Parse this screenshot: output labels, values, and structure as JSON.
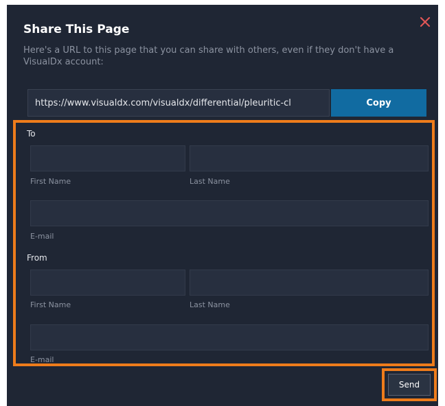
{
  "dialog": {
    "title": "Share This Page",
    "description": "Here's a URL to this page that you can share with others, even if they don't have a VisualDx account:",
    "close_icon": "close-icon",
    "close_color": "#e05656"
  },
  "share_url": {
    "value": "https://www.visualdx.com/visualdx/differential/pleuritic-cl",
    "copy_label": "Copy"
  },
  "to": {
    "heading": "To",
    "first_name_label": "First Name",
    "last_name_label": "Last Name",
    "email_label": "E-mail"
  },
  "from": {
    "heading": "From",
    "first_name_label": "First Name",
    "last_name_label": "Last Name",
    "email_label": "E-mail"
  },
  "send_label": "Send",
  "colors": {
    "dialog_bg": "#1f2634",
    "input_bg": "#272f3f",
    "accent_blue": "#116ba1",
    "highlight_orange": "#ee7c1b"
  }
}
